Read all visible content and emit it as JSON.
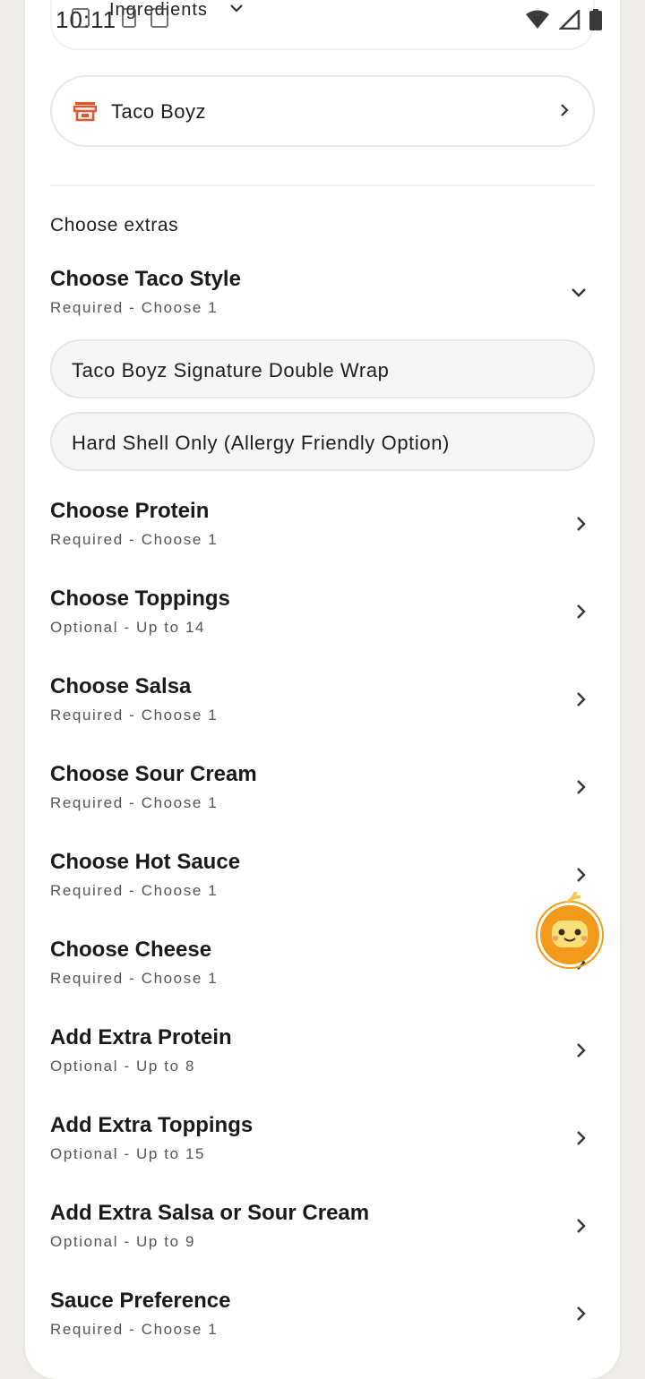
{
  "status_bar": {
    "time": "10:11",
    "icons": [
      "notification-icon",
      "sim-icon",
      "screenshot-icon",
      "wifi-icon",
      "signal-icon",
      "battery-icon"
    ]
  },
  "ingredients": {
    "label": "Ingredients"
  },
  "store": {
    "name": "Taco Boyz",
    "icon": "store-icon"
  },
  "extras": {
    "heading": "Choose extras",
    "expanded_group": {
      "title": "Choose Taco Style",
      "subtitle": "Required - Choose 1",
      "options": [
        "Taco Boyz Signature Double Wrap",
        "Hard Shell Only (Allergy Friendly Option)"
      ]
    },
    "groups": [
      {
        "title": "Choose Protein",
        "subtitle": "Required - Choose 1"
      },
      {
        "title": "Choose Toppings",
        "subtitle": "Optional - Up to 14"
      },
      {
        "title": "Choose Salsa",
        "subtitle": "Required - Choose 1"
      },
      {
        "title": "Choose Sour Cream",
        "subtitle": "Required - Choose 1"
      },
      {
        "title": "Choose Hot Sauce",
        "subtitle": "Required - Choose 1"
      },
      {
        "title": "Choose Cheese",
        "subtitle": "Required - Choose 1"
      },
      {
        "title": "Add Extra Protein",
        "subtitle": "Optional - Up to 8"
      },
      {
        "title": "Add Extra Toppings",
        "subtitle": "Optional - Up to 15"
      },
      {
        "title": "Add Extra Salsa or Sour Cream",
        "subtitle": "Optional - Up to 9"
      },
      {
        "title": "Sauce Preference",
        "subtitle": "Required - Choose 1"
      }
    ]
  },
  "colors": {
    "brand_orange": "#e8542c",
    "mascot_orange": "#f39a1a",
    "mascot_face": "#f7e07a"
  }
}
